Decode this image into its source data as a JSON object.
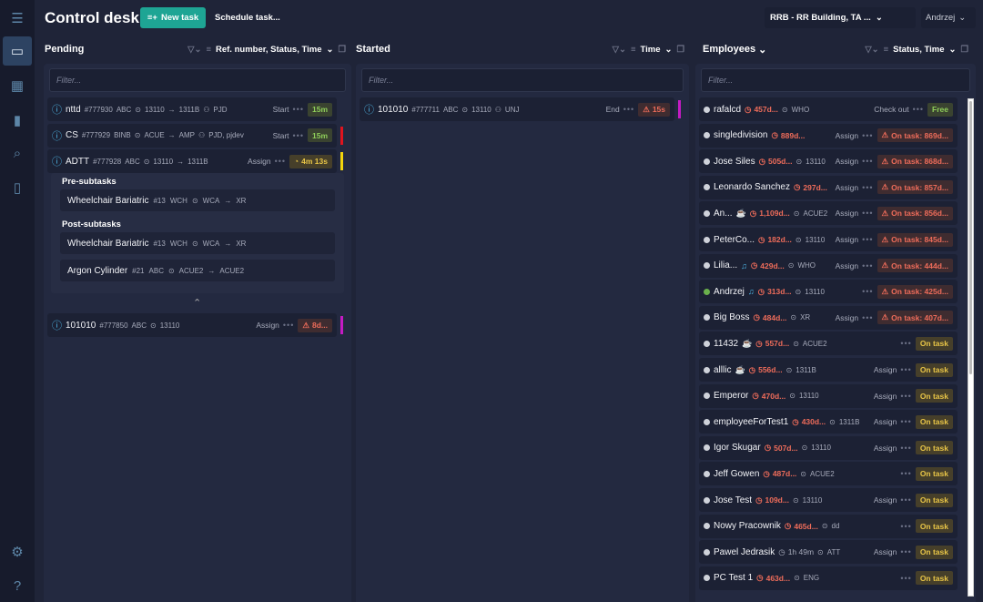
{
  "app": {
    "title": "Control desk",
    "new_task": "New task",
    "schedule_task": "Schedule task...",
    "building": "RRB - RR Building, TA ...",
    "user": "Andrzej"
  },
  "sidebar": {
    "items": [
      {
        "icon": "menu-icon"
      },
      {
        "icon": "monitor-icon",
        "active": true
      },
      {
        "icon": "calendar-icon"
      },
      {
        "icon": "chart-icon"
      },
      {
        "icon": "search-icon"
      },
      {
        "icon": "map-icon"
      },
      {
        "icon": "gear-icon"
      },
      {
        "icon": "help-icon"
      }
    ]
  },
  "pending": {
    "title": "Pending",
    "sort": "Ref. number, Status, Time",
    "filter_placeholder": "Filter...",
    "tasks": [
      {
        "name": "nttd",
        "ref": "#777930",
        "cat": "ABC",
        "from": "13110",
        "to": "1311B",
        "people": "PJD",
        "action": "Start",
        "badge": "15m",
        "kind": "green",
        "mark": ""
      },
      {
        "name": "CS",
        "ref": "#777929",
        "cat": "BINB",
        "from": "ACUE",
        "to": "AMP",
        "people": "PJD, pjdev",
        "action": "Start",
        "badge": "15m",
        "kind": "green",
        "mark": "#e0141e"
      },
      {
        "name": "ADTT",
        "ref": "#777928",
        "cat": "ABC",
        "from": "13110",
        "to": "1311B",
        "people": "",
        "action": "Assign",
        "badge": "4m 13s",
        "kind": "yellow",
        "mark": "#f2d40c"
      }
    ],
    "pre_label": "Pre-subtasks",
    "post_label": "Post-subtasks",
    "pre": [
      {
        "name": "Wheelchair Bariatric",
        "ref": "#13",
        "cat": "WCH",
        "from": "WCA",
        "to": "XR"
      }
    ],
    "post": [
      {
        "name": "Wheelchair Bariatric",
        "ref": "#13",
        "cat": "WCH",
        "from": "WCA",
        "to": "XR"
      },
      {
        "name": "Argon Cylinder",
        "ref": "#21",
        "cat": "ABC",
        "from": "ACUE2",
        "to": "ACUE2"
      }
    ],
    "last": {
      "name": "101010",
      "ref": "#777850",
      "cat": "ABC",
      "from": "13110",
      "action": "Assign",
      "badge": "8d...",
      "kind": "red",
      "mark": "#c41bc4"
    }
  },
  "started": {
    "title": "Started",
    "sort": "Time",
    "filter_placeholder": "Filter...",
    "tasks": [
      {
        "name": "101010",
        "ref": "#777711",
        "cat": "ABC",
        "from": "13110",
        "people": "UNJ",
        "action": "End",
        "badge": "15s",
        "kind": "red",
        "mark": "#c41bc4"
      }
    ]
  },
  "employees": {
    "title": "Employees",
    "sort": "Status, Time",
    "filter_placeholder": "Filter...",
    "list": [
      {
        "name": "rafalcd",
        "time": "457d...",
        "loc": "WHO",
        "action": "Check out",
        "badge": "Free",
        "kind": "green"
      },
      {
        "name": "singledivision",
        "time": "889d...",
        "loc": "",
        "action": "Assign",
        "badge": "On task: 869d...",
        "kind": "red"
      },
      {
        "name": "Jose Siles",
        "time": "505d...",
        "loc": "13110",
        "action": "Assign",
        "badge": "On task: 868d...",
        "kind": "red"
      },
      {
        "name": "Leonardo Sanchez",
        "time": "297d...",
        "loc": "",
        "action": "Assign",
        "badge": "On task: 857d...",
        "kind": "red"
      },
      {
        "name": "An...",
        "icon": "coffee-icon",
        "time": "1,109d...",
        "loc": "ACUE2",
        "action": "Assign",
        "badge": "On task: 856d...",
        "kind": "red"
      },
      {
        "name": "PeterCo...",
        "time": "182d...",
        "loc": "13110",
        "action": "Assign",
        "badge": "On task: 845d...",
        "kind": "red"
      },
      {
        "name": "Lilia...",
        "icon": "earbuds-icon",
        "time": "429d...",
        "loc": "WHO",
        "action": "Assign",
        "badge": "On task: 444d...",
        "kind": "red"
      },
      {
        "name": "Andrzej",
        "online": true,
        "icon": "earbuds-icon",
        "time": "313d...",
        "loc": "13110",
        "action": "",
        "badge": "On task: 425d...",
        "kind": "red"
      },
      {
        "name": "Big Boss",
        "time": "484d...",
        "loc": "XR",
        "action": "Assign",
        "badge": "On task: 407d...",
        "kind": "red"
      },
      {
        "name": "11432",
        "icon": "coffee-icon",
        "time": "557d...",
        "loc": "ACUE2",
        "action": "",
        "badge": "On task",
        "kind": "yellow"
      },
      {
        "name": "alllic",
        "icon": "coffee-icon",
        "time": "556d...",
        "loc": "1311B",
        "action": "Assign",
        "badge": "On task",
        "kind": "yellow"
      },
      {
        "name": "Emperor",
        "time": "470d...",
        "loc": "13110",
        "action": "Assign",
        "badge": "On task",
        "kind": "yellow"
      },
      {
        "name": "employeeForTest1",
        "time": "430d...",
        "loc": "1311B",
        "action": "Assign",
        "badge": "On task",
        "kind": "yellow"
      },
      {
        "name": "Igor Skugar",
        "time": "507d...",
        "loc": "13110",
        "action": "Assign",
        "badge": "On task",
        "kind": "yellow"
      },
      {
        "name": "Jeff Gowen",
        "time": "487d...",
        "loc": "ACUE2",
        "action": "",
        "badge": "On task",
        "kind": "yellow"
      },
      {
        "name": "Jose Test",
        "time": "109d...",
        "loc": "13110",
        "action": "Assign",
        "badge": "On task",
        "kind": "yellow"
      },
      {
        "name": "Nowy Pracownik",
        "time": "465d...",
        "loc": "dd",
        "action": "",
        "badge": "On task",
        "kind": "yellow"
      },
      {
        "name": "Pawel Jedrasik",
        "time": "1h 49m",
        "gray": true,
        "loc": "ATT",
        "action": "Assign",
        "badge": "On task",
        "kind": "yellow"
      },
      {
        "name": "PC Test 1",
        "time": "463d...",
        "loc": "ENG",
        "action": "",
        "badge": "On task",
        "kind": "yellow"
      }
    ]
  },
  "colors": {
    "accent": "#1ea594",
    "sidebar": "#171b2c",
    "background": "#1f2438",
    "red": "#ee6c5a",
    "yellow": "#e8c547",
    "green": "#8fcf5a",
    "online": "#6ab04c"
  }
}
